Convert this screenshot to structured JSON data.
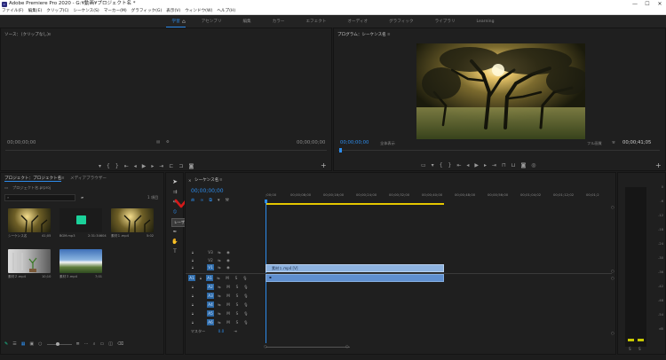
{
  "window": {
    "title": "Adobe Premiere Pro 2020 - G:¥動画¥プロジェクト名 *",
    "app_icon": "Pr",
    "controls": [
      "—",
      "☐",
      "✕"
    ]
  },
  "menu": [
    "ファイル(F)",
    "編集(E)",
    "クリップ(C)",
    "シーケンス(S)",
    "マーカー(M)",
    "グラフィック(G)",
    "表示(V)",
    "ウィンドウ(W)",
    "ヘルプ(H)"
  ],
  "workspace": {
    "tabs": [
      "学習",
      "アセンブリ",
      "編集",
      "カラー",
      "エフェクト",
      "オーディオ",
      "グラフィック",
      "ライブラリ",
      "Learning"
    ],
    "active_index": 0
  },
  "source": {
    "title": "ソース：（クリップなし）",
    "tc_left": "00;00;00;00",
    "tc_right": "00;00;00;00"
  },
  "program": {
    "title": "プログラム：シーケンス名",
    "tc_left": "00;00;00;00",
    "fit": "全体表示",
    "quality": "フル画質",
    "tc_right": "00;00;41;05"
  },
  "project": {
    "tab1": "プロジェクト：プロジェクト名",
    "tab2": "メディアブラウザー",
    "file": "プロジェクト名.prproj",
    "count": "1 項目",
    "items": [
      {
        "name": "シーケンス名",
        "dur": "41;05"
      },
      {
        "name": "BGM.mp3",
        "dur": "2:31:34604"
      },
      {
        "name": "素材１.mp4",
        "dur": "5:02"
      },
      {
        "name": "素材２.mp4",
        "dur": "10;10"
      },
      {
        "name": "素材３.mp4",
        "dur": "7;01"
      }
    ]
  },
  "tools": {
    "tooltip": "レーザーツール (C)"
  },
  "timeline": {
    "tab": "シーケンス名",
    "tc": "00;00;00;00",
    "ruler": [
      ";00;00",
      "00;00;08;00",
      "00;00;16;00",
      "00;00;24;00",
      "00;00;32;00",
      "00;00;40;00",
      "00;00;48;00",
      "00;00;56;00",
      "00;01;04;02",
      "00;01;12;02",
      "00;01;2"
    ],
    "video_tracks": [
      "V3",
      "V2",
      "V1"
    ],
    "audio_tracks": [
      "A1",
      "A2",
      "A3",
      "A4",
      "A5",
      "A6"
    ],
    "master_label": "マスター",
    "master_value": "0.0",
    "clip_label": "素材１.mp4 [V]"
  },
  "meter": {
    "ticks": [
      "0",
      "-6",
      "-12",
      "-18",
      "-24",
      "-30",
      "-36",
      "-42",
      "-48",
      "-54",
      "dB"
    ],
    "s_labels": [
      "S",
      "S"
    ]
  },
  "colors": {
    "accent": "#2d8ceb",
    "clip_video": "#8eb3e0",
    "clip_audio": "#5f8fcf",
    "track_active": "#2d6aa8",
    "workarea": "#e5c700",
    "check": "#d51a1a",
    "green_clip": "#1bd19a"
  }
}
